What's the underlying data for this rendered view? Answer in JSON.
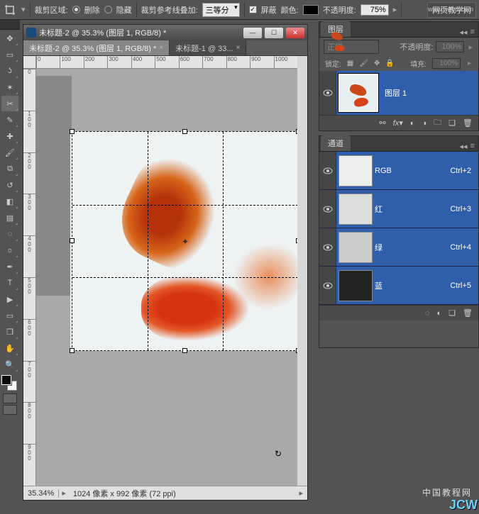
{
  "options_bar": {
    "crop_area_label": "裁剪区域:",
    "delete_label": "删除",
    "hide_label": "隐藏",
    "guide_label": "裁剪参考线叠加:",
    "guide_value": "三等分",
    "shield_label": "屏蔽",
    "color_label": "颜色:",
    "opacity_label": "不透明度:",
    "opacity_value": "75%",
    "brand": "网页教学网"
  },
  "window": {
    "title": "未标题-2 @ 35.3% (图层 1, RGB/8) *",
    "tabs": [
      {
        "label": "未标题-2 @ 35.3% (图层 1, RGB/8) *",
        "active": true
      },
      {
        "label": "未标题-1 @ 33...",
        "active": false
      }
    ],
    "ruler_h": [
      "0",
      "100",
      "200",
      "300",
      "400",
      "500",
      "600",
      "700",
      "800",
      "900",
      "1000"
    ],
    "zoom": "35.34%",
    "doc_info": "1024 像素 x 992 像素 (72 ppi)"
  },
  "layers": {
    "tab": "图层",
    "blend_mode": "正常",
    "opacity_label": "不透明度:",
    "opacity_value": "100%",
    "lock_label": "锁定:",
    "fill_label": "填充:",
    "fill_value": "100%",
    "items": [
      {
        "name": "图层 1"
      }
    ]
  },
  "channels": {
    "tab": "通道",
    "items": [
      {
        "name": "RGB",
        "shortcut": "Ctrl+2",
        "class": "rgb"
      },
      {
        "name": "红",
        "shortcut": "Ctrl+3",
        "class": "red"
      },
      {
        "name": "绿",
        "shortcut": "Ctrl+4",
        "class": "green"
      },
      {
        "name": "蓝",
        "shortcut": "Ctrl+5",
        "class": "blue"
      }
    ]
  },
  "watermarks": {
    "main": "JCW",
    "cn": "中国教程网",
    "url": "www.webjx.com"
  }
}
